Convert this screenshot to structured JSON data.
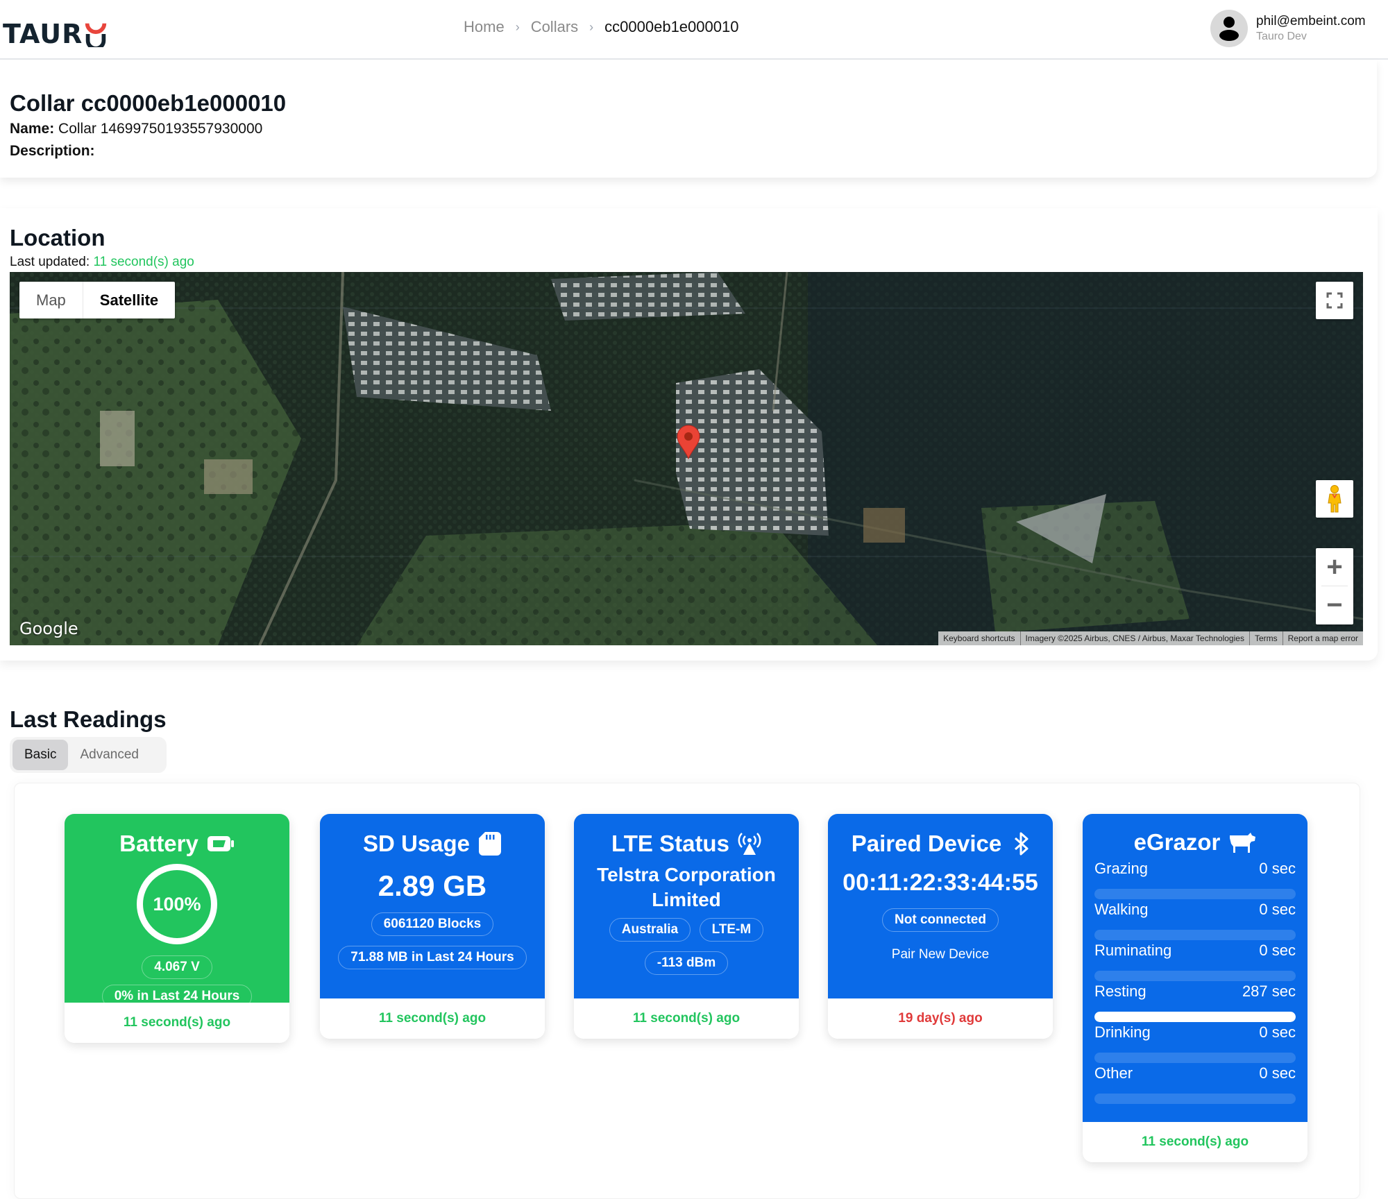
{
  "header": {
    "logo_text": "TAUR",
    "breadcrumb": [
      "Home",
      "Collars",
      "cc0000eb1e000010"
    ],
    "user_email": "phil@embeint.com",
    "user_org": "Tauro Dev"
  },
  "collar": {
    "title": "Collar cc0000eb1e000010",
    "name_label": "Name:",
    "name_value": "Collar 14699750193557930000",
    "description_label": "Description:",
    "description_value": ""
  },
  "location": {
    "title": "Location",
    "last_updated_label": "Last updated:",
    "last_updated_value": "11 second(s) ago",
    "map": {
      "type_options": [
        "Map",
        "Satellite"
      ],
      "selected_type": "Satellite",
      "google_label": "Google",
      "attribution": [
        "Keyboard shortcuts",
        "Imagery ©2025 Airbus, CNES / Airbus, Maxar Technologies",
        "Terms",
        "Report a map error"
      ],
      "zoom_in": "+",
      "zoom_out": "−",
      "marker_color": "#ea4335"
    }
  },
  "readings": {
    "title": "Last Readings",
    "tabs": [
      "Basic",
      "Advanced"
    ],
    "active_tab": "Basic",
    "battery": {
      "title": "Battery",
      "percent_label": "100%",
      "percent": 100,
      "voltage": "4.067 V",
      "change": "0% in Last 24 Hours",
      "updated": "11 second(s) ago",
      "color": "#22c55e"
    },
    "sd": {
      "title": "SD Usage",
      "value": "2.89 GB",
      "blocks": "6061120 Blocks",
      "change": "71.88 MB in Last 24 Hours",
      "updated": "11 second(s) ago"
    },
    "lte": {
      "title": "LTE Status",
      "operator": "Telstra Corporation Limited",
      "country": "Australia",
      "technology": "LTE-M",
      "signal": "-113 dBm",
      "updated": "11 second(s) ago"
    },
    "paired": {
      "title": "Paired Device",
      "mac": "00:11:22:33:44:55",
      "status": "Not connected",
      "action": "Pair New Device",
      "updated": "19 day(s) ago"
    },
    "egrazor": {
      "title": "eGrazor",
      "activities": [
        {
          "label": "Grazing",
          "value": "0 sec",
          "seconds": 0
        },
        {
          "label": "Walking",
          "value": "0 sec",
          "seconds": 0
        },
        {
          "label": "Ruminating",
          "value": "0 sec",
          "seconds": 0
        },
        {
          "label": "Resting",
          "value": "287 sec",
          "seconds": 287
        },
        {
          "label": "Drinking",
          "value": "0 sec",
          "seconds": 0
        },
        {
          "label": "Other",
          "value": "0 sec",
          "seconds": 0
        }
      ],
      "updated": "11 second(s) ago"
    },
    "colors": {
      "blue": "#0a6ae8",
      "green": "#22c55e",
      "red": "#e03a3a"
    }
  }
}
